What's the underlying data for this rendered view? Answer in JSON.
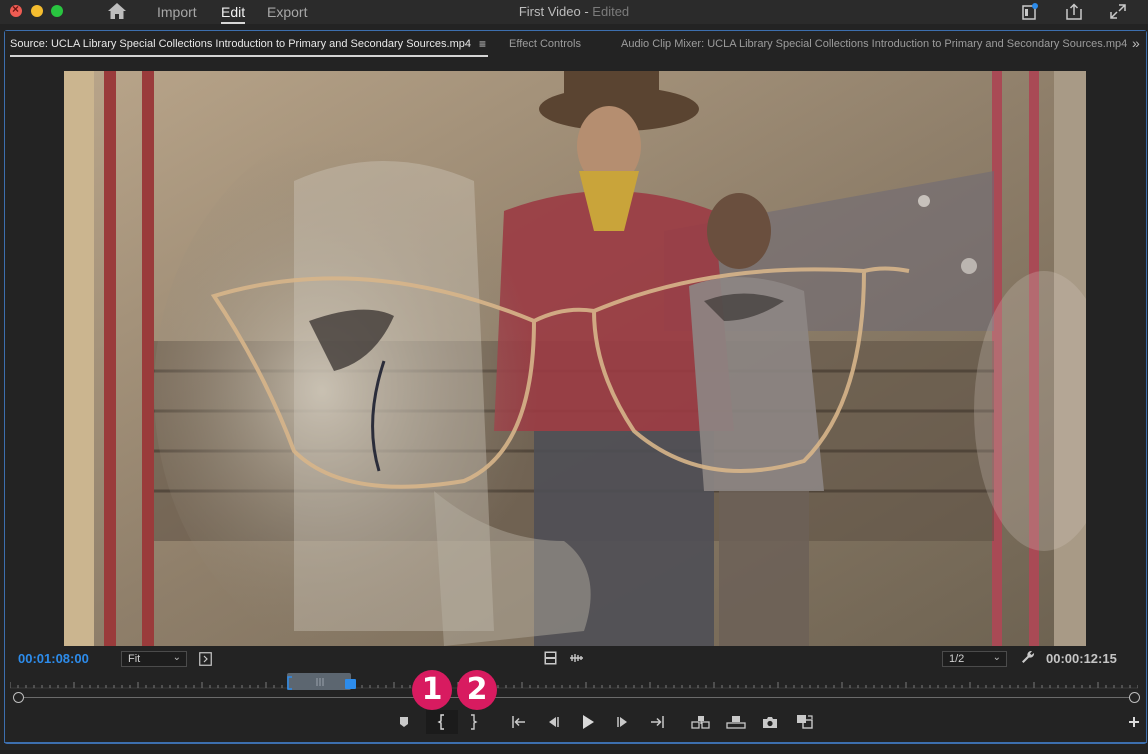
{
  "app": {
    "window_title": "First Video",
    "window_status": "Edited",
    "title_separator": " - "
  },
  "menu": {
    "import": "Import",
    "edit": "Edit",
    "export": "Export",
    "active": "Edit"
  },
  "tabs": {
    "source": "Source: UCLA Library Special Collections Introduction to Primary and Secondary Sources.mp4",
    "source_menu": "≡",
    "effect_controls": "Effect Controls",
    "audio_clip_mixer": "Audio Clip Mixer: UCLA Library Special Collections Introduction to Primary and Secondary Sources.mp4",
    "overflow": "»"
  },
  "monitor": {
    "playhead_timecode": "00:01:08:00",
    "zoom_select": "Fit",
    "resolution_select": "1/2",
    "duration_timecode": "00:00:12:15"
  },
  "callouts": {
    "first": "1",
    "second": "2"
  },
  "colors": {
    "accent_blue": "#2d8ceb",
    "callout": "#d81b60",
    "panel_border": "#3d6fae"
  },
  "icons": {
    "home": "home-icon",
    "notifications": "notification-icon",
    "share": "share-icon",
    "fullscreen": "fullscreen-icon",
    "settings": "wrench-icon"
  }
}
